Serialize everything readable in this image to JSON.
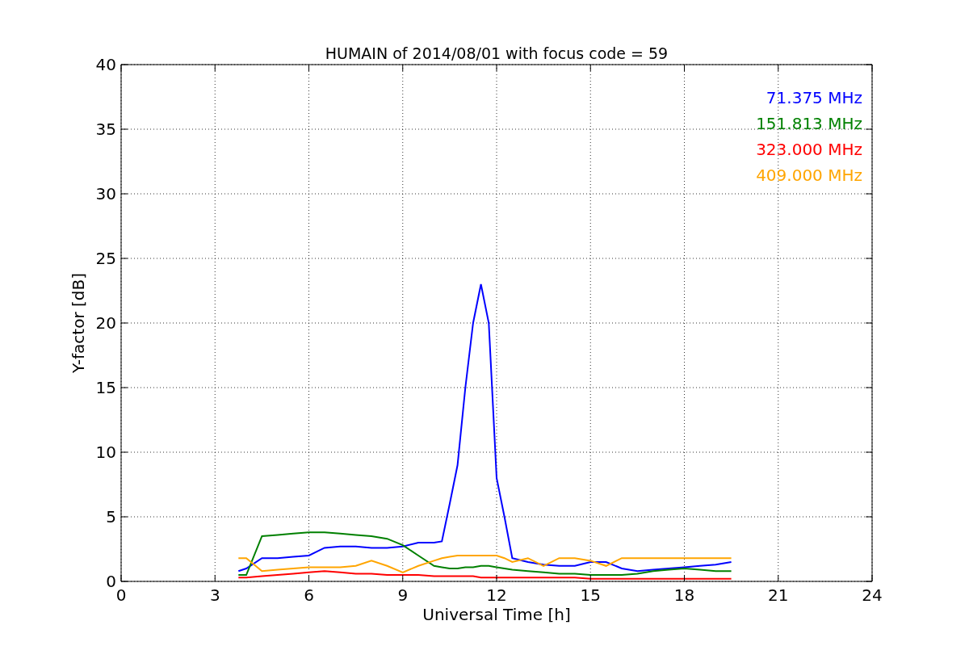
{
  "chart_data": {
    "type": "line",
    "grid": true,
    "title": "HUMAIN of 2014/08/01 with focus code = 59",
    "xlabel": "Universal Time [h]",
    "ylabel": "Y-factor [dB]",
    "xlim": [
      0,
      24
    ],
    "ylim": [
      0,
      40
    ],
    "xticks": [
      0,
      3,
      6,
      9,
      12,
      15,
      18,
      21,
      24
    ],
    "yticks": [
      0,
      5,
      10,
      15,
      20,
      25,
      30,
      35,
      40
    ],
    "x": [
      3.75,
      4,
      4.5,
      5,
      5.5,
      6,
      6.5,
      7,
      7.5,
      8,
      8.5,
      9,
      9.5,
      10,
      10.25,
      10.5,
      10.75,
      11,
      11.25,
      11.5,
      11.75,
      12,
      12.25,
      12.5,
      13,
      13.5,
      14,
      14.5,
      15,
      15.5,
      16,
      16.5,
      17,
      17.5,
      18,
      18.5,
      19,
      19.5
    ],
    "series": [
      {
        "name": "71.375 MHz",
        "color": "#0000ff",
        "values": [
          0.8,
          1.0,
          1.8,
          1.8,
          1.9,
          2.0,
          2.6,
          2.7,
          2.7,
          2.6,
          2.6,
          2.7,
          3.0,
          3.0,
          3.1,
          6.0,
          9.0,
          15.0,
          20.0,
          23.0,
          20.0,
          8.0,
          5.0,
          1.8,
          1.5,
          1.3,
          1.2,
          1.2,
          1.5,
          1.5,
          1.0,
          0.8,
          0.9,
          1.0,
          1.1,
          1.2,
          1.3,
          1.5
        ]
      },
      {
        "name": "151.813 MHz",
        "color": "#008000",
        "values": [
          0.5,
          0.5,
          3.5,
          3.6,
          3.7,
          3.8,
          3.8,
          3.7,
          3.6,
          3.5,
          3.3,
          2.8,
          2.0,
          1.2,
          1.1,
          1.0,
          1.0,
          1.1,
          1.1,
          1.2,
          1.2,
          1.1,
          1.0,
          0.9,
          0.8,
          0.7,
          0.6,
          0.6,
          0.5,
          0.5,
          0.5,
          0.6,
          0.8,
          0.9,
          1.0,
          0.9,
          0.8,
          0.8
        ]
      },
      {
        "name": "323.000 MHz",
        "color": "#ff0000",
        "values": [
          0.3,
          0.3,
          0.4,
          0.5,
          0.6,
          0.7,
          0.8,
          0.7,
          0.6,
          0.6,
          0.5,
          0.5,
          0.5,
          0.4,
          0.4,
          0.4,
          0.4,
          0.4,
          0.4,
          0.3,
          0.3,
          0.3,
          0.3,
          0.3,
          0.3,
          0.3,
          0.3,
          0.3,
          0.2,
          0.2,
          0.2,
          0.2,
          0.2,
          0.2,
          0.2,
          0.2,
          0.2,
          0.2
        ]
      },
      {
        "name": "409.000 MHz",
        "color": "#ffa500",
        "values": [
          1.8,
          1.8,
          0.8,
          0.9,
          1.0,
          1.1,
          1.1,
          1.1,
          1.2,
          1.6,
          1.2,
          0.7,
          1.2,
          1.6,
          1.8,
          1.9,
          2.0,
          2.0,
          2.0,
          2.0,
          2.0,
          2.0,
          1.8,
          1.5,
          1.8,
          1.2,
          1.8,
          1.8,
          1.6,
          1.2,
          1.8,
          1.8,
          1.8,
          1.8,
          1.8,
          1.8,
          1.8,
          1.8
        ]
      }
    ]
  }
}
